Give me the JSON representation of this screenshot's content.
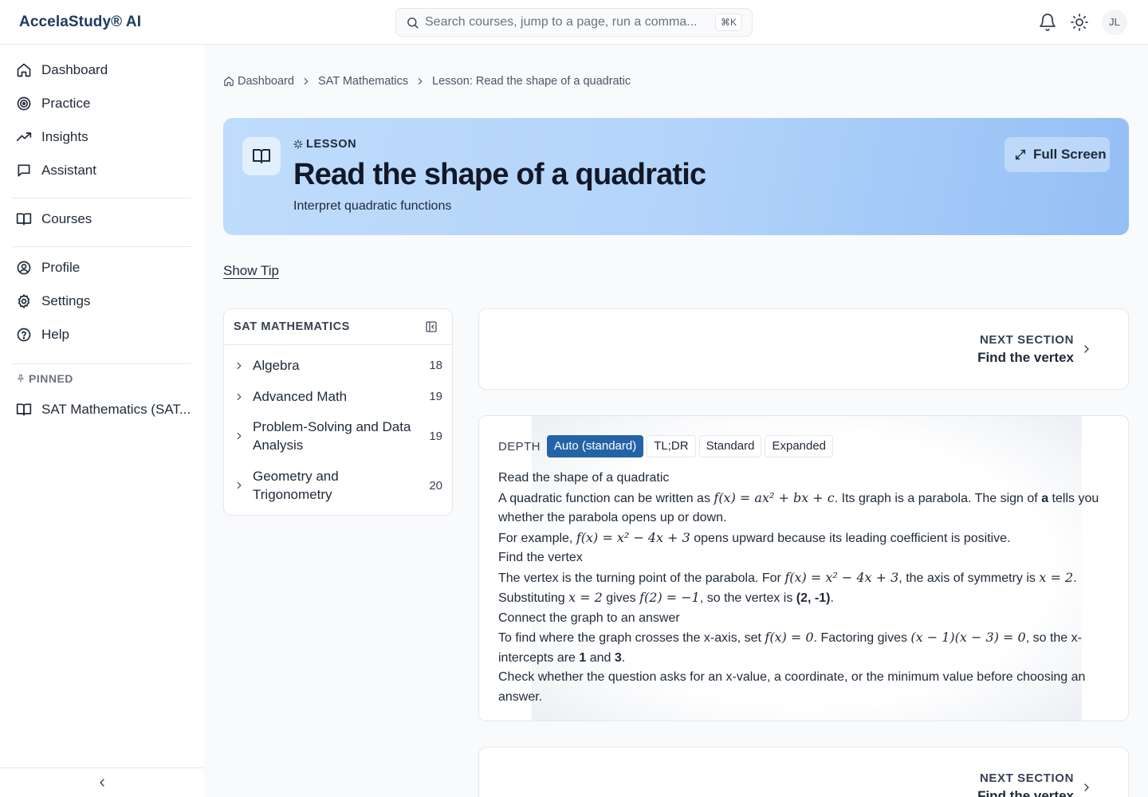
{
  "brand": {
    "name": "AccelaStudy® AI"
  },
  "search": {
    "placeholder": "Search courses, jump to a page, run a comma...",
    "shortcut": "⌘K"
  },
  "topbar": {
    "avatar_initials": "JL"
  },
  "sidebar": {
    "primary": [
      {
        "label": "Dashboard",
        "icon": "home-icon"
      },
      {
        "label": "Practice",
        "icon": "target-icon"
      },
      {
        "label": "Insights",
        "icon": "trending-up-icon"
      },
      {
        "label": "Assistant",
        "icon": "chat-icon"
      }
    ],
    "secondary": [
      {
        "label": "Courses",
        "icon": "book-icon"
      }
    ],
    "account": [
      {
        "label": "Profile",
        "icon": "user-circle-icon"
      },
      {
        "label": "Settings",
        "icon": "gear-icon"
      },
      {
        "label": "Help",
        "icon": "help-circle-icon"
      }
    ],
    "pinned_heading": "PINNED",
    "pinned": [
      {
        "label": "SAT Mathematics (SAT...",
        "icon": "book-icon"
      }
    ]
  },
  "breadcrumb": {
    "items": [
      "Dashboard",
      "SAT Mathematics",
      "Lesson: Read the shape of a quadratic"
    ]
  },
  "lesson": {
    "kicker": "LESSON",
    "title": "Read the shape of a quadratic",
    "subtitle": "Interpret quadratic functions",
    "fullscreen_label": "Full Screen"
  },
  "show_tip_label": "Show Tip",
  "toc": {
    "title": "SAT MATHEMATICS",
    "items": [
      {
        "label": "Algebra",
        "count": "18"
      },
      {
        "label": "Advanced Math",
        "count": "19"
      },
      {
        "label": "Problem-Solving and Data Analysis",
        "count": "19"
      },
      {
        "label": "Geometry and Trigonometry",
        "count": "20"
      }
    ]
  },
  "next_section": {
    "kicker": "NEXT SECTION",
    "title": "Find the vertex"
  },
  "depth": {
    "label": "DEPTH",
    "options": [
      "Auto (standard)",
      "TL;DR",
      "Standard",
      "Expanded"
    ],
    "selected": "Auto (standard)"
  },
  "content": {
    "p1": "Read the shape of a quadratic",
    "p2_a": "A quadratic function can be written as ",
    "p2_math": "f(x) = ax² + bx + c",
    "p2_b": ". Its graph is a parabola. The sign of ",
    "p2_bold": "a",
    "p2_c": " tells you whether the parabola opens up or down.",
    "p3_a": "For example, ",
    "p3_math": "f(x) = x² − 4x + 3",
    "p3_b": " opens upward because its leading coefficient is positive.",
    "p4": "Find the vertex",
    "p5_a": "The vertex is the turning point of the parabola. For ",
    "p5_math1": "f(x) = x² − 4x + 3",
    "p5_b": ", the axis of symmetry is ",
    "p5_math2": "x = 2",
    "p5_c": ". Substituting ",
    "p5_math3": "x = 2",
    "p5_d": " gives ",
    "p5_math4": "f(2) = −1",
    "p5_e": ", so the vertex is ",
    "p5_bold": "(2, -1)",
    "p5_f": ".",
    "p6": "Connect the graph to an answer",
    "p7_a": "To find where the graph crosses the x-axis, set ",
    "p7_math1": "f(x) = 0",
    "p7_b": ". Factoring gives ",
    "p7_math2": "(x − 1)(x − 3) = 0",
    "p7_c": ", so the x-intercepts are ",
    "p7_bold1": "1",
    "p7_d": " and ",
    "p7_bold2": "3",
    "p7_e": ".",
    "p8": "Check whether the question asks for an x-value, a coordinate, or the minimum value before choosing an answer."
  },
  "colors": {
    "brand": "#1e3a5f",
    "accent": "#2563a8",
    "hero_gradient_start": "#bfdcfb",
    "hero_gradient_end": "#94bff5",
    "main_background": "#f8fafc",
    "border": "#e5e7eb"
  }
}
